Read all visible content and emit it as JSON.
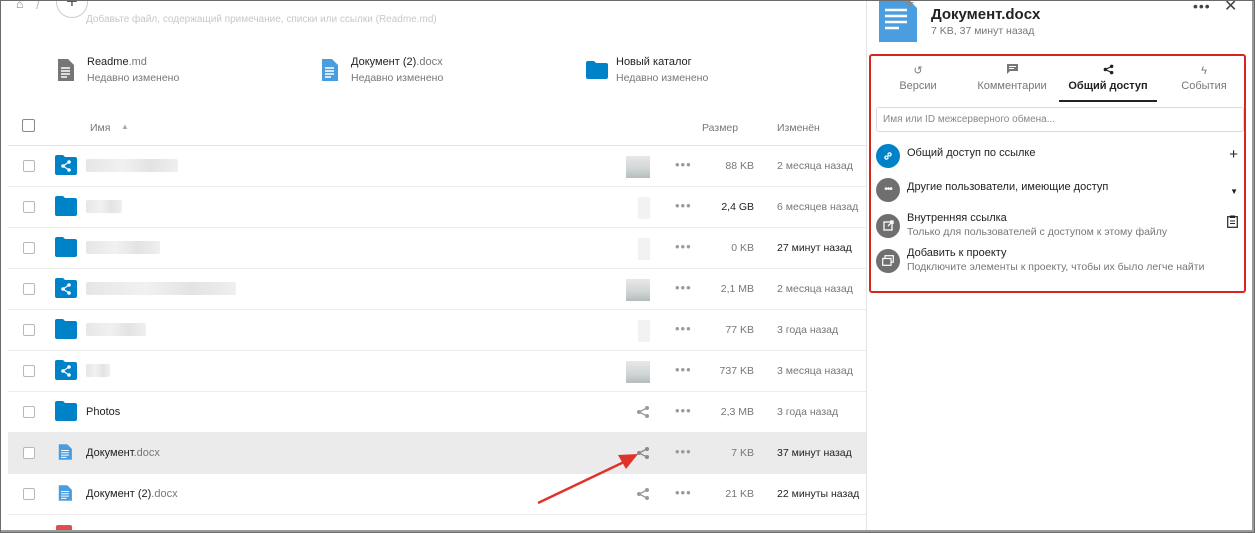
{
  "topbar": {
    "add_label": "+",
    "description_hint": "Добавьте файл, содержащий примечание, списки или ссылки (Readme.md)"
  },
  "recent": [
    {
      "name": "Readme",
      "ext": ".md",
      "sub": "Недавно изменено",
      "icon": "text-file-icon"
    },
    {
      "name": "Документ (2)",
      "ext": ".docx",
      "sub": "Недавно изменено",
      "icon": "doc-file-icon"
    },
    {
      "name": "Новый каталог",
      "ext": "",
      "sub": "Недавно изменено",
      "icon": "folder-icon"
    }
  ],
  "table": {
    "col_name": "Имя",
    "col_size": "Размер",
    "col_modified": "Изменён",
    "rows": [
      {
        "name": "",
        "size": "88 KB",
        "modified": "2 месяца назад"
      },
      {
        "name": "",
        "size": "2,4 GB",
        "modified": "6 месяцев назад"
      },
      {
        "name": "",
        "size": "0 KB",
        "modified": "27 минут назад"
      },
      {
        "name": "",
        "size": "2,1 MB",
        "modified": "2 месяца назад"
      },
      {
        "name": "",
        "size": "77 KB",
        "modified": "3 года назад"
      },
      {
        "name": "",
        "size": "737 KB",
        "modified": "3 месяца назад"
      },
      {
        "name": "Photos",
        "ext": "",
        "size": "2,3 MB",
        "modified": "3 года назад"
      },
      {
        "name": "Документ",
        "ext": ".docx",
        "size": "7 KB",
        "modified": "37 минут назад"
      },
      {
        "name": "Документ (2)",
        "ext": ".docx",
        "size": "21 KB",
        "modified": "22 минуты назад"
      }
    ]
  },
  "sidebar": {
    "title": "Документ.docx",
    "subtitle": "7 KB, 37 минут назад",
    "tabs": [
      {
        "label": "Версии",
        "icon": "history-icon"
      },
      {
        "label": "Комментарии",
        "icon": "comment-icon"
      },
      {
        "label": "Общий доступ",
        "icon": "share-icon"
      },
      {
        "label": "События",
        "icon": "activity-icon"
      }
    ],
    "share_placeholder": "Имя или ID межсерверного обмена...",
    "link_share": "Общий доступ по ссылке",
    "others_access": "Другие пользователи, имеющие доступ",
    "internal_link_title": "Внутренняя ссылка",
    "internal_link_sub": "Только для пользователей с доступом к этому файлу",
    "project_title": "Добавить к проекту",
    "project_sub": "Подключите элементы к проекту, чтобы их было легче найти"
  },
  "colors": {
    "folder": "#0082c9",
    "highlight_box": "#d9261c",
    "doc_icon": "#4a9ee0"
  }
}
